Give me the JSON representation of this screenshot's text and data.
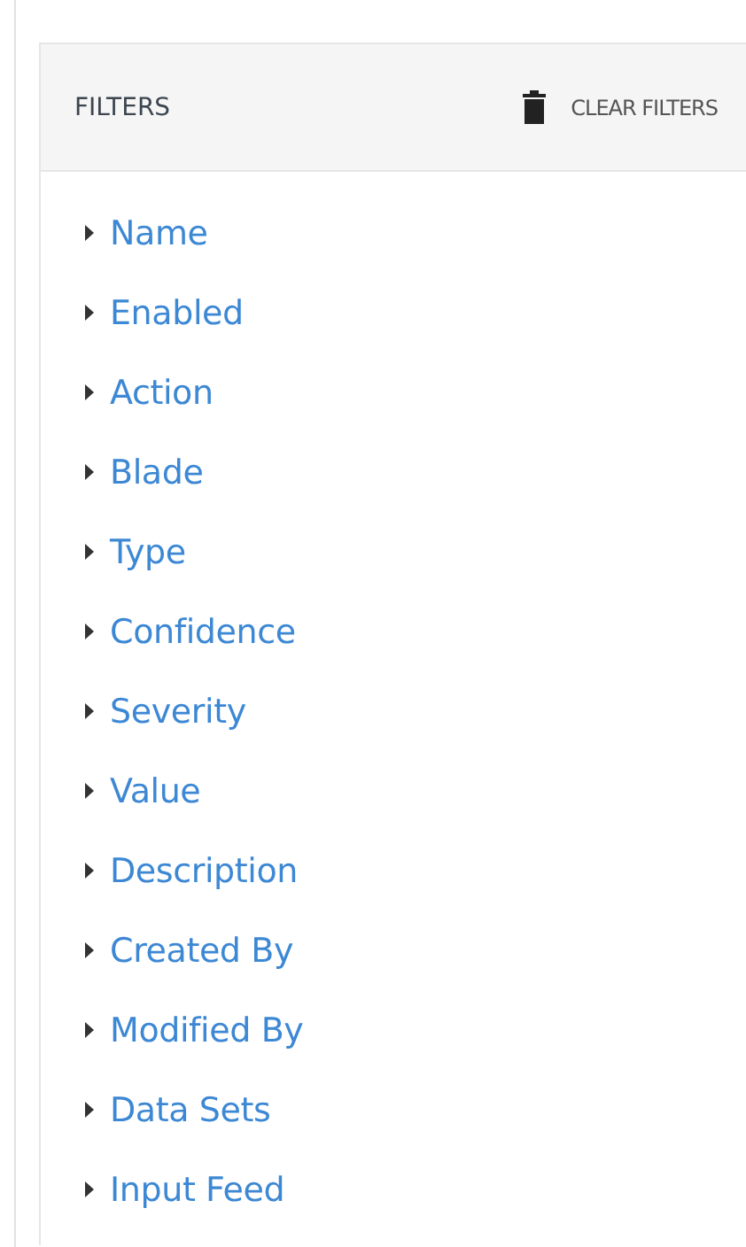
{
  "panel": {
    "title": "FILTERS",
    "clear_button": "CLEAR FILTERS"
  },
  "filters": [
    {
      "label": "Name",
      "expanded": false
    },
    {
      "label": "Enabled",
      "expanded": false
    },
    {
      "label": "Action",
      "expanded": false
    },
    {
      "label": "Blade",
      "expanded": false
    },
    {
      "label": "Type",
      "expanded": false
    },
    {
      "label": "Confidence",
      "expanded": false
    },
    {
      "label": "Severity",
      "expanded": false
    },
    {
      "label": "Value",
      "expanded": false
    },
    {
      "label": "Description",
      "expanded": false
    },
    {
      "label": "Created By",
      "expanded": false
    },
    {
      "label": "Modified By",
      "expanded": false
    },
    {
      "label": "Data Sets",
      "expanded": false
    },
    {
      "label": "Input Feed",
      "expanded": false
    }
  ]
}
